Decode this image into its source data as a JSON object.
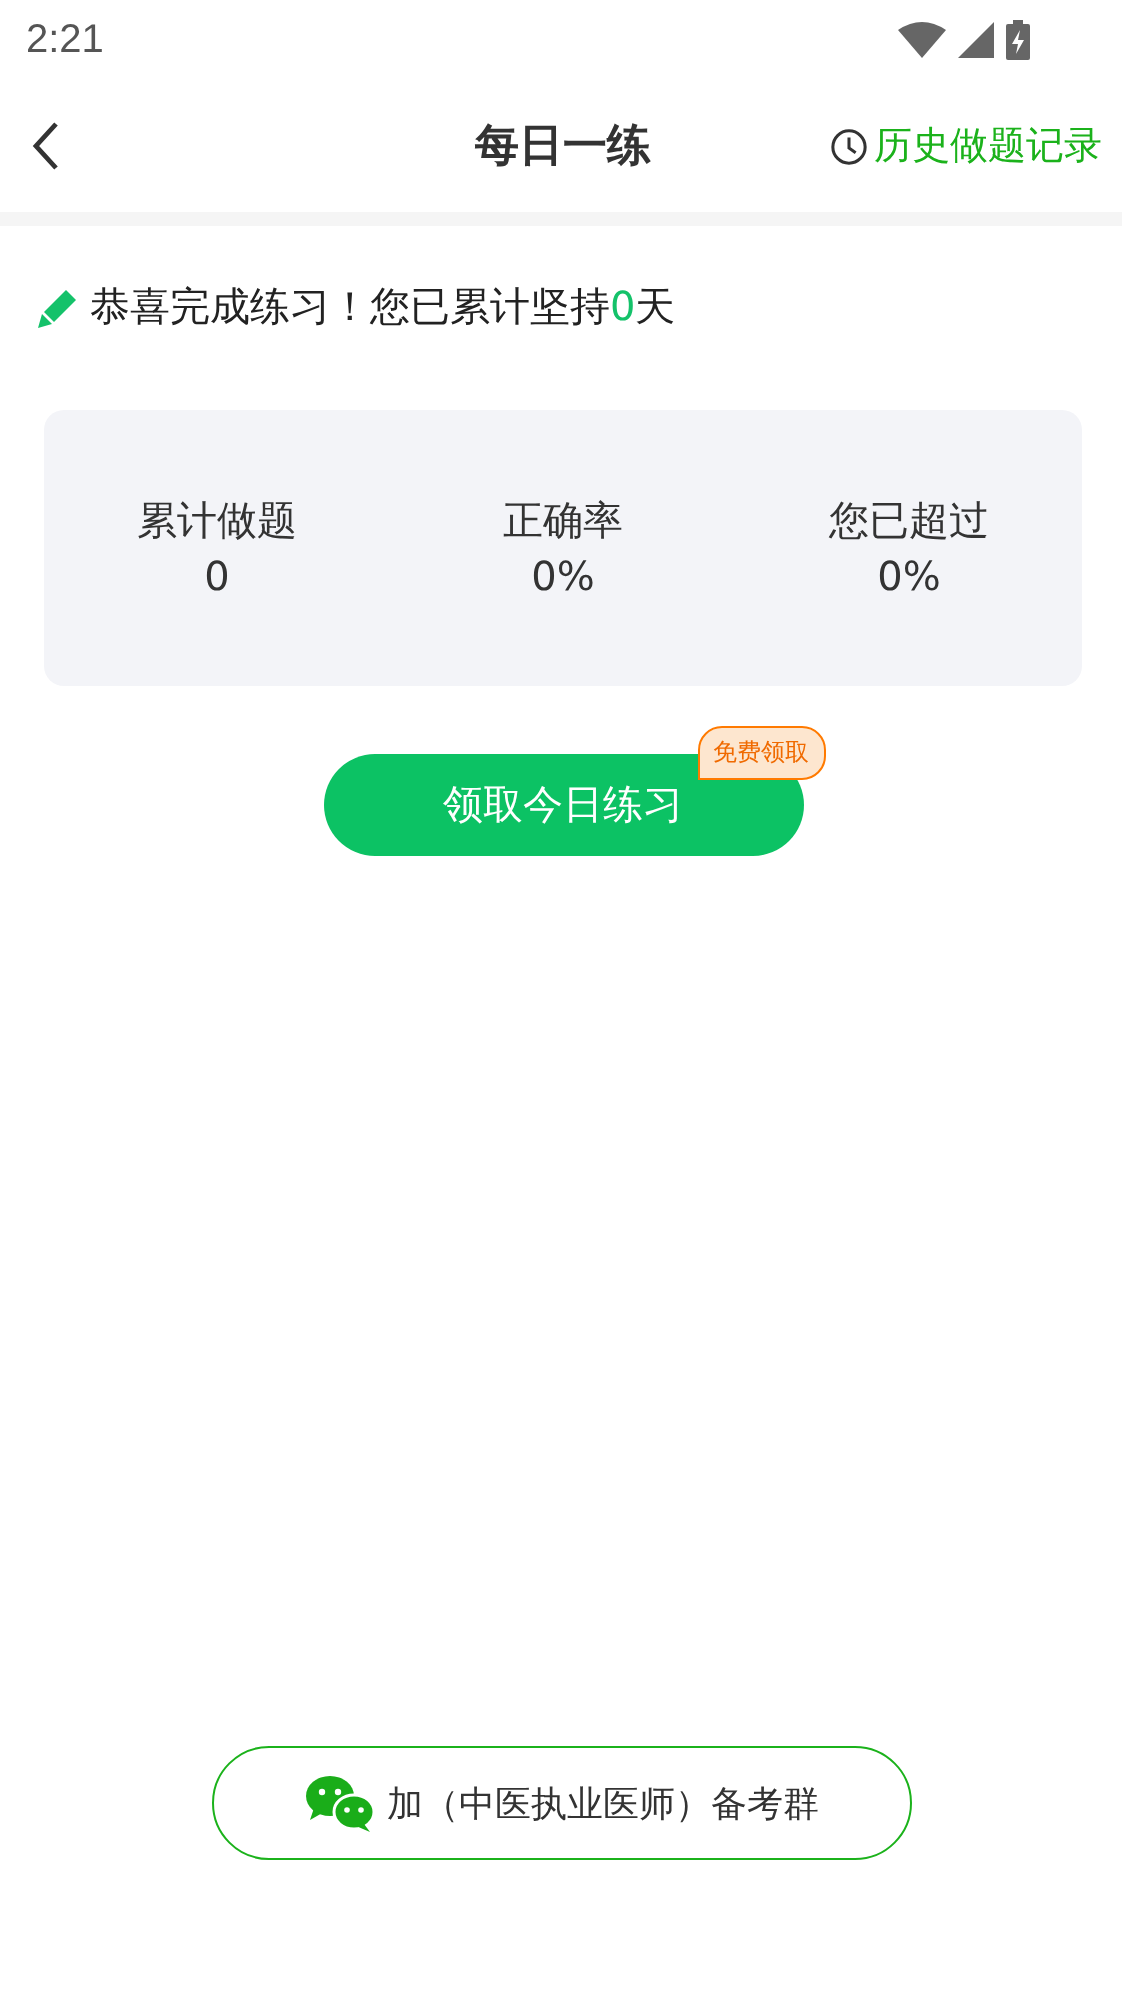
{
  "status_bar": {
    "time": "2:21"
  },
  "header": {
    "title": "每日一练",
    "history_link": "历史做题记录"
  },
  "message": {
    "before": "恭喜完成练习！您已累计坚持",
    "days": "0",
    "after": "天"
  },
  "stats": [
    {
      "label": "累计做题",
      "value": "0"
    },
    {
      "label": "正确率",
      "value": "0%"
    },
    {
      "label": "您已超过",
      "value": "0%"
    }
  ],
  "claim_button": {
    "label": "领取今日练习",
    "badge": "免费领取"
  },
  "group_button": {
    "label": "加（中医执业医师）备考群"
  }
}
